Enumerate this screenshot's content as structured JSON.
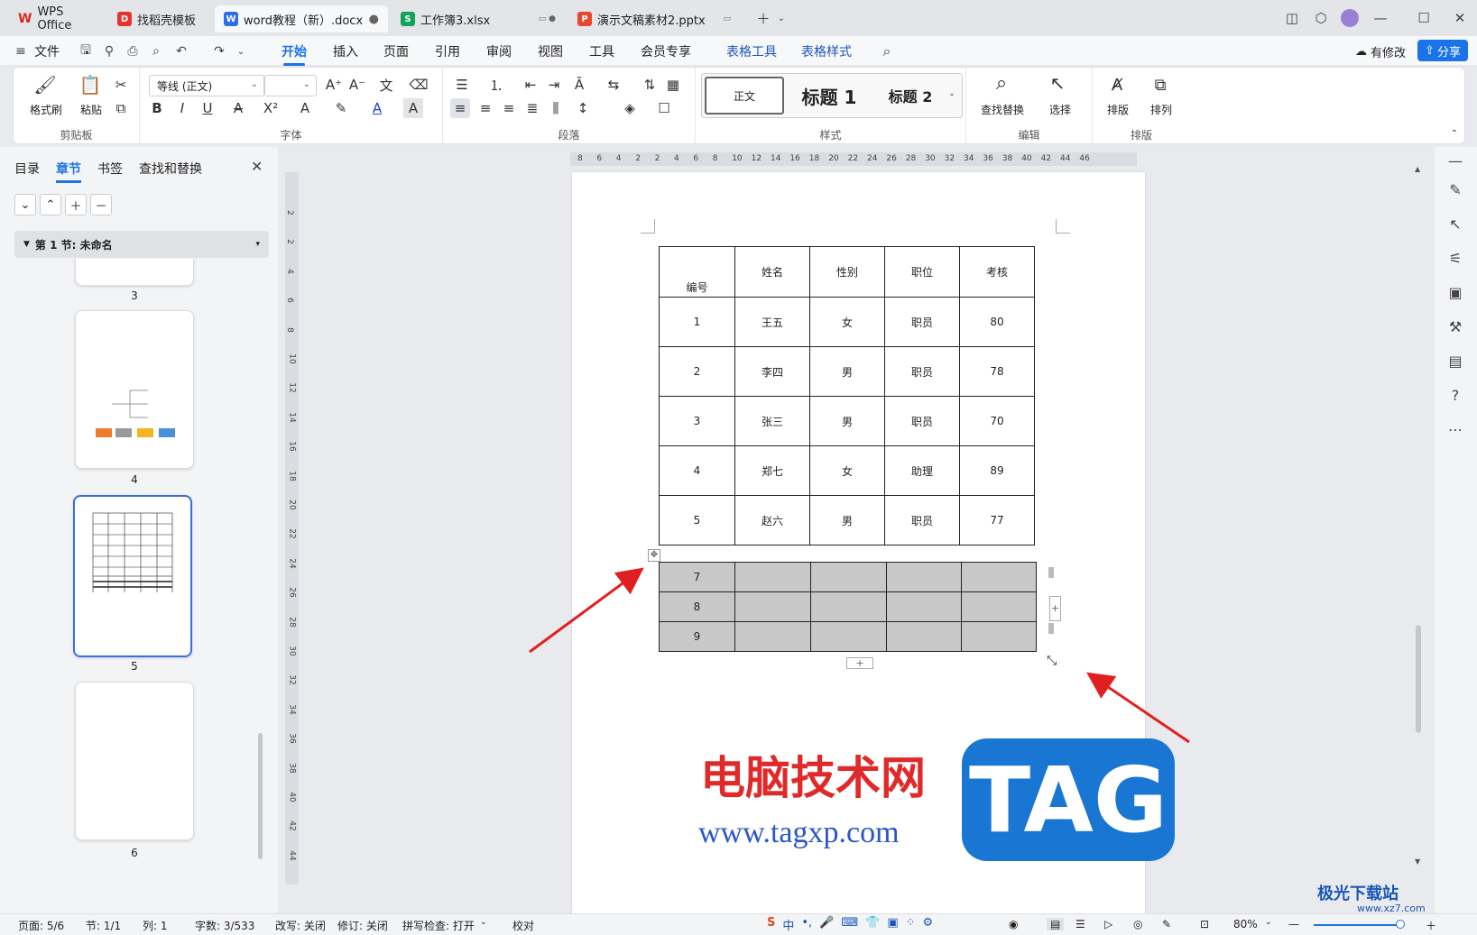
{
  "tabs": [
    {
      "label": "WPS Office",
      "icon": "wps-logo-icon",
      "color": "#d9261c"
    },
    {
      "label": "找稻壳模板",
      "icon": "docer-icon",
      "color": "#e8332d"
    },
    {
      "label": "word教程（新）.docx",
      "icon": "W",
      "color": "#2f6de8",
      "active": true
    },
    {
      "label": "工作簿3.xlsx",
      "icon": "S",
      "color": "#13a35b"
    },
    {
      "label": "演示文稿素材2.pptx",
      "icon": "P",
      "color": "#e8472d"
    }
  ],
  "menu": {
    "file": "文件",
    "items": [
      "开始",
      "插入",
      "页面",
      "引用",
      "审阅",
      "视图",
      "工具",
      "会员专享",
      "表格工具",
      "表格样式"
    ],
    "active": "开始",
    "modified": "有修改",
    "share": "分享"
  },
  "ribbon": {
    "clipboard": {
      "format_painter": "格式刷",
      "paste": "粘贴",
      "label": "剪贴板"
    },
    "font": {
      "name": "等线 (正文)",
      "size": "",
      "label": "字体"
    },
    "paragraph": {
      "label": "段落"
    },
    "styles": {
      "normal": "正文",
      "h1": "标题 1",
      "h2": "标题 2",
      "label": "样式"
    },
    "edit": {
      "find_replace": "查找替换",
      "select": "选择",
      "label": "编辑"
    },
    "arrange": {
      "layout": "排版",
      "order": "排列",
      "label": "排版"
    }
  },
  "left_panel": {
    "tabs": [
      "目录",
      "章节",
      "书签",
      "查找和替换"
    ],
    "active_tab": "章节",
    "section": "第 1 节: 未命名",
    "pages": [
      "3",
      "4",
      "5",
      "6"
    ],
    "selected_page": "5"
  },
  "ruler_top": [
    "8",
    "6",
    "4",
    "2",
    "2",
    "4",
    "6",
    "8",
    "10",
    "12",
    "14",
    "16",
    "18",
    "20",
    "22",
    "24",
    "26",
    "28",
    "30",
    "32",
    "34",
    "36",
    "38",
    "40",
    "42",
    "44",
    "46"
  ],
  "ruler_left": [
    "2",
    "2",
    "4",
    "6",
    "8",
    "10",
    "12",
    "14",
    "16",
    "18",
    "20",
    "22",
    "24",
    "26",
    "28",
    "30",
    "32",
    "34",
    "36",
    "38",
    "40",
    "42",
    "44"
  ],
  "table": {
    "headers": [
      "编号",
      "姓名",
      "性别",
      "职位",
      "考核"
    ],
    "rows": [
      [
        "1",
        "王五",
        "女",
        "职员",
        "80"
      ],
      [
        "2",
        "李四",
        "男",
        "职员",
        "78"
      ],
      [
        "3",
        "张三",
        "男",
        "职员",
        "70"
      ],
      [
        "4",
        "郑七",
        "女",
        "助理",
        "89"
      ],
      [
        "5",
        "赵六",
        "男",
        "职员",
        "77"
      ]
    ],
    "selected_rows": [
      [
        "7",
        "",
        "",
        "",
        ""
      ],
      [
        "8",
        "",
        "",
        "",
        ""
      ],
      [
        "9",
        "",
        "",
        "",
        ""
      ]
    ]
  },
  "watermark": {
    "text_cn": "电脑技术网",
    "url": "www.tagxp.com",
    "tag": "TAG",
    "site": "极光下载站",
    "site_url": "www.xz7.com"
  },
  "status": {
    "page": "页面: 5/6",
    "section": "节: 1/1",
    "column": "列: 1",
    "words": "字数: 3/533",
    "overtype": "改写: 关闭",
    "revision": "修订: 关闭",
    "spellcheck": "拼写检查: 打开",
    "proof": "校对",
    "zoom": "80%"
  },
  "colors": {
    "accent": "#1a73e8",
    "selection": "#c8c8c8",
    "arrow": "#e02020",
    "tag_blue": "#1976d2",
    "watermark_red": "#e02a2a"
  }
}
